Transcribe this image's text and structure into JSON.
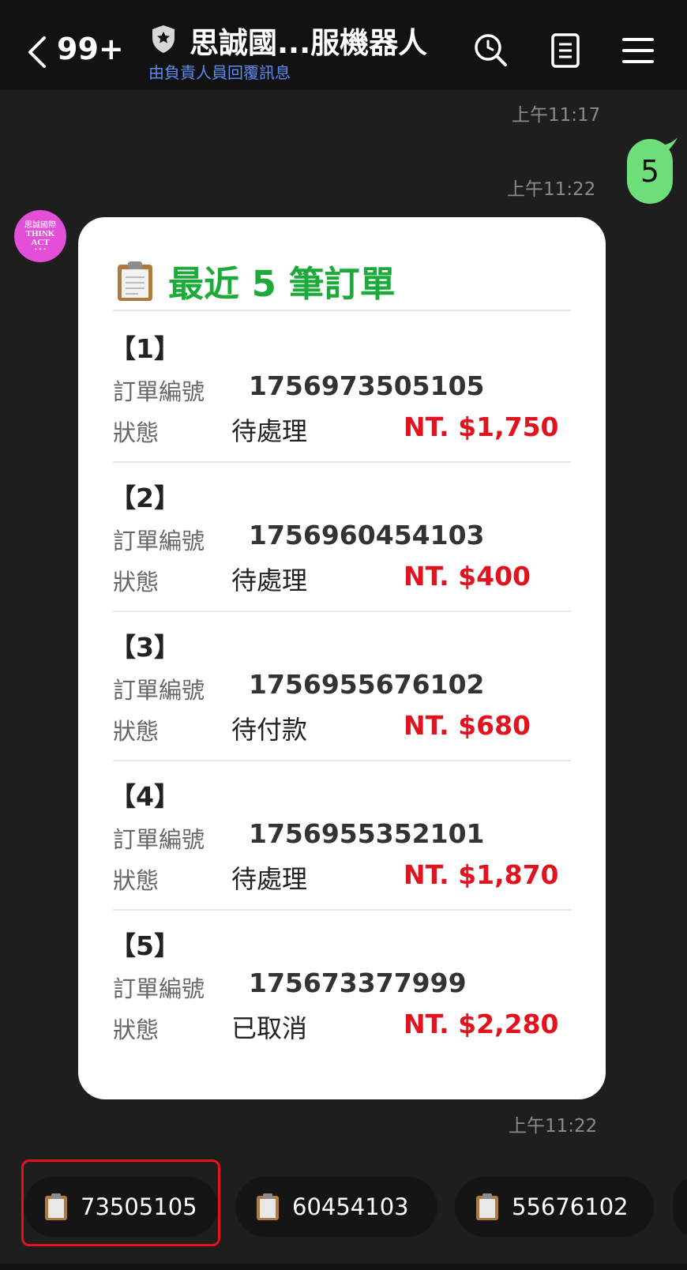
{
  "header": {
    "unread_count": "99+",
    "title": "思誠國...服機器人",
    "subtitle": "由負責人員回覆訊息"
  },
  "chat": {
    "time_1": "上午11:17",
    "user_message": "5",
    "user_time": "上午11:22",
    "bot_time": "上午11:22",
    "avatar": {
      "line1": "思誠國際",
      "line2": "THINK",
      "line3": "ACT"
    }
  },
  "card": {
    "title": "最近 5 筆訂單",
    "order_label": "訂單編號",
    "status_label": "狀態",
    "orders": [
      {
        "index": "【1】",
        "number": "1756973505105",
        "status": "待處理",
        "amount": "NT. $1,750"
      },
      {
        "index": "【2】",
        "number": "1756960454103",
        "status": "待處理",
        "amount": "NT. $400"
      },
      {
        "index": "【3】",
        "number": "1756955676102",
        "status": "待付款",
        "amount": "NT. $680"
      },
      {
        "index": "【4】",
        "number": "1756955352101",
        "status": "待處理",
        "amount": "NT. $1,870"
      },
      {
        "index": "【5】",
        "number": "175673377999",
        "status": "已取消",
        "amount": "NT. $2,280"
      }
    ]
  },
  "quick_replies": [
    "73505105",
    "60454103",
    "55676102"
  ],
  "colors": {
    "accent_green": "#1ea93b",
    "amount_red": "#e0131f",
    "user_bubble": "#6ede7b",
    "highlight_red": "#e3121c",
    "link_blue": "#5b8cf0"
  },
  "icons": [
    "chevron-left-icon",
    "shield-icon",
    "search-icon",
    "notes-icon",
    "menu-icon",
    "clipboard-icon"
  ]
}
